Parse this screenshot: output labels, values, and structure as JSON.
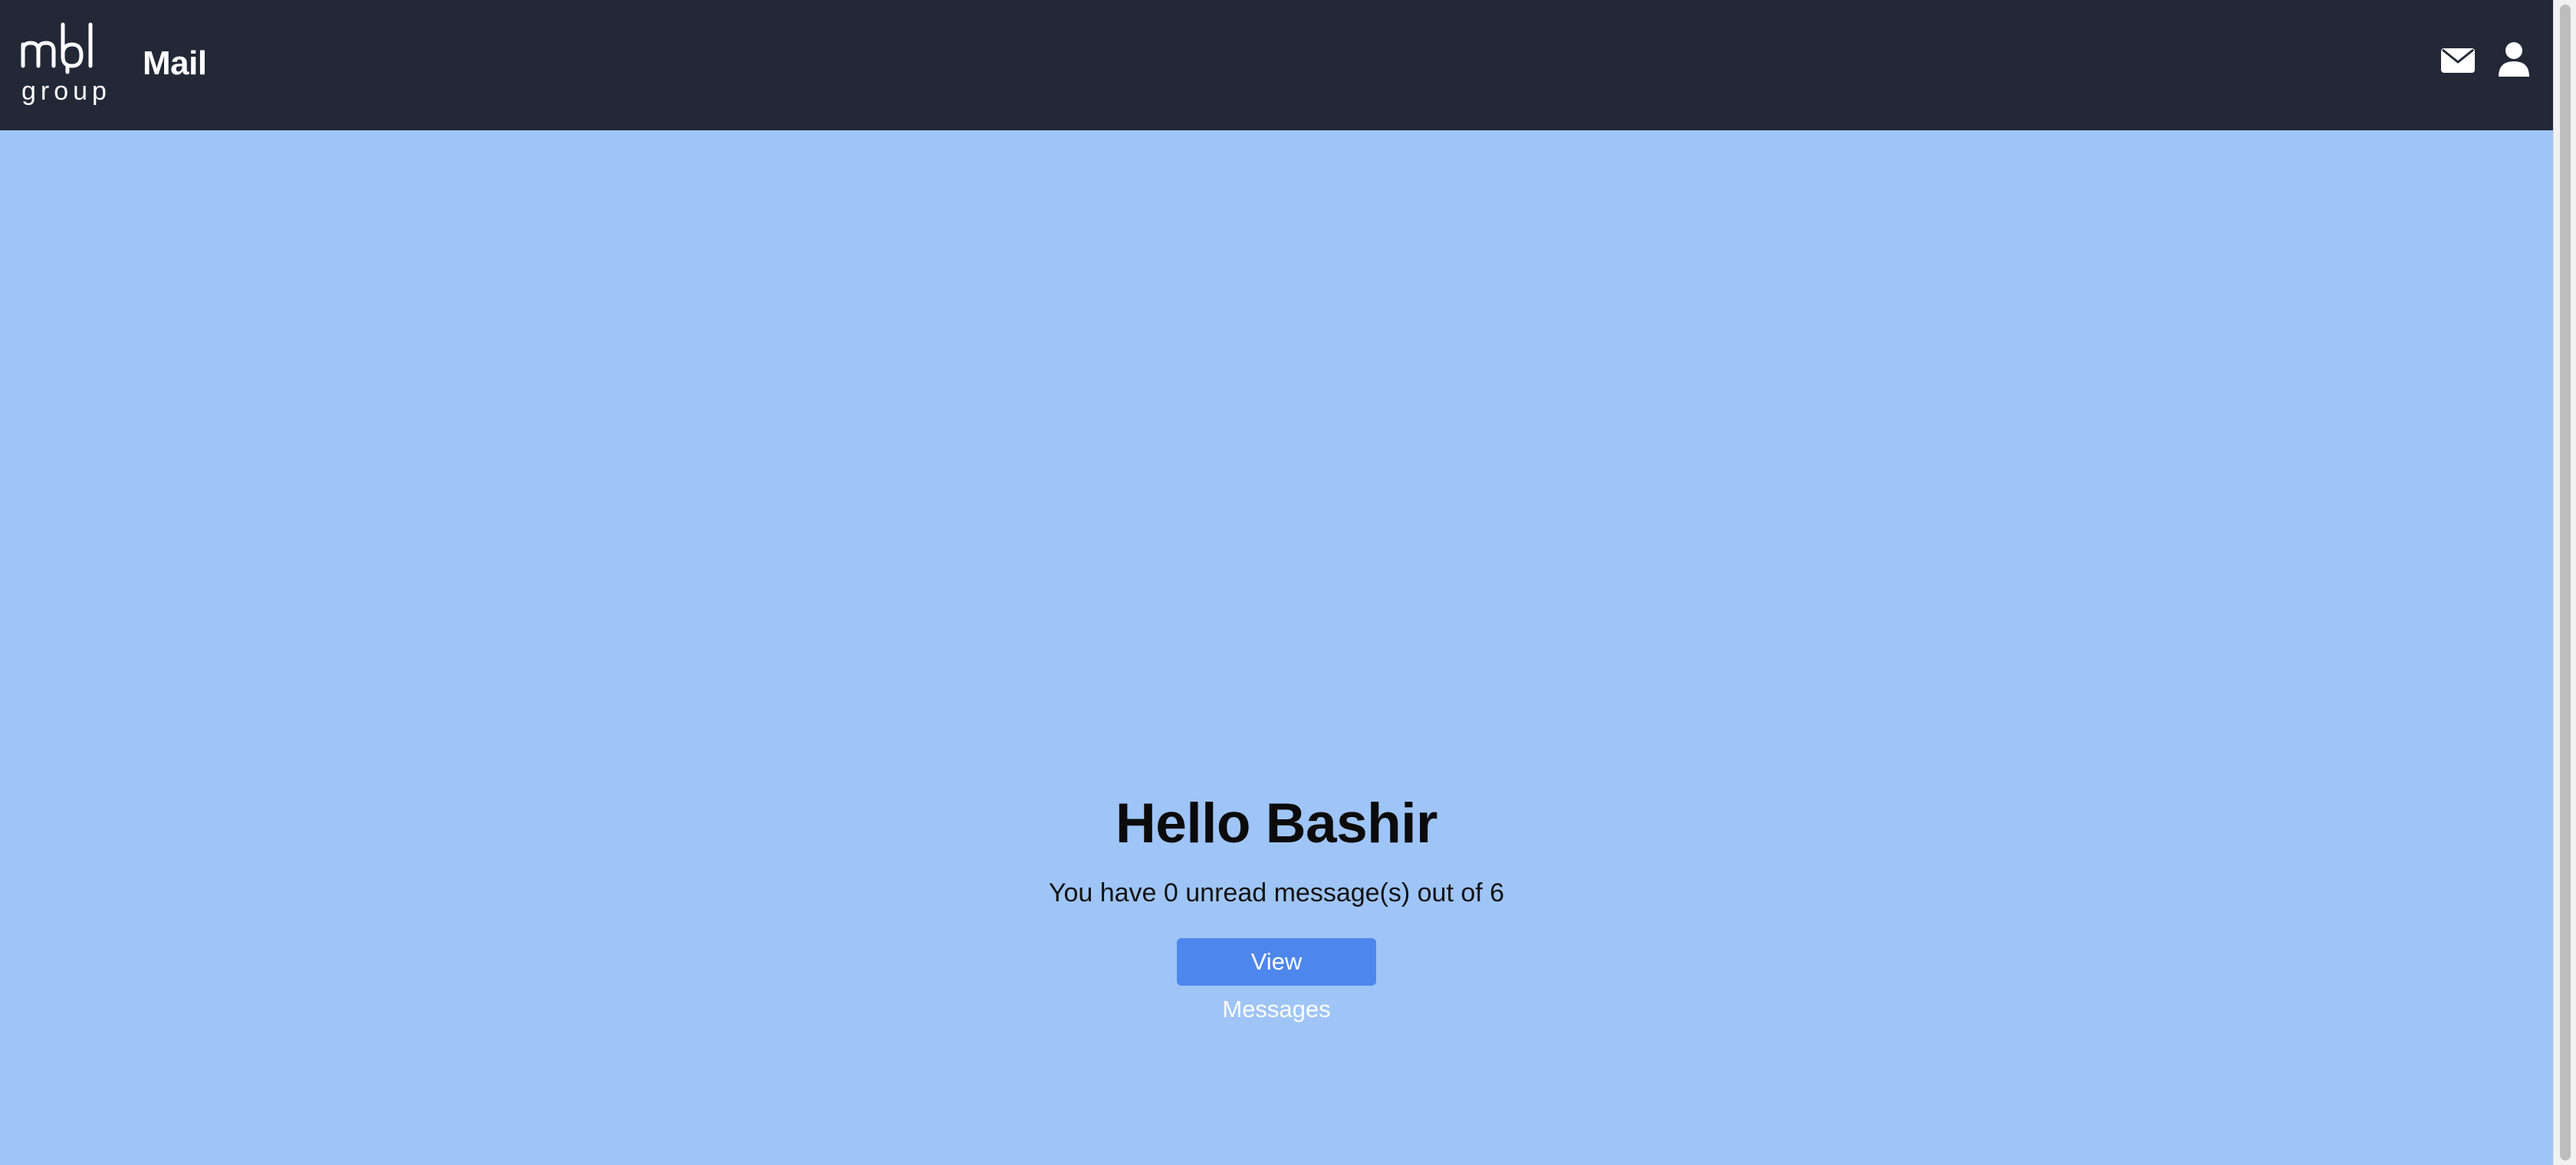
{
  "header": {
    "logo_text_top": "mbl",
    "logo_text_bottom": "group",
    "title": "Mail",
    "icons": [
      "envelope-icon",
      "user-icon"
    ]
  },
  "main": {
    "greeting": "Hello Bashir",
    "summary": "You have 0 unread message(s) out of 6",
    "view_button_label": "View Messages"
  },
  "colors": {
    "topbar_bg": "#222836",
    "page_bg": "#9fc5f7",
    "button_bg": "#4d86ec",
    "button_text": "#ffffff"
  }
}
